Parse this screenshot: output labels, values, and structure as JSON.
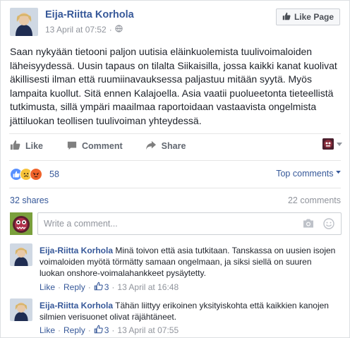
{
  "post": {
    "author": "Eija-Riitta Korhola",
    "timestamp": "13 April at 07:52",
    "separator": "·",
    "like_page_label": "Like Page",
    "text": "Saan nykyään tietooni paljon uutisia eläinkuolemista tuulivoimaloiden läheisyydessä. Uusin tapaus on tilalta Siikaisilla, jossa kaikki kanat kuolivat äkillisesti ilman että ruumiinavauksessa paljastuu mitään syytä. Myös lampaita kuollut. Sitä ennen Kalajoella. Asia vaatii puolueetonta tieteellistä tutkimusta, sillä ympäri maailmaa raportoidaan vastaavista ongelmista jättiluokan teollisen tuulivoiman yhteydessä."
  },
  "actions": {
    "like": "Like",
    "comment": "Comment",
    "share": "Share"
  },
  "reactions": {
    "count": "58",
    "icons": [
      "like-reaction-icon",
      "sad-reaction-icon",
      "angry-reaction-icon"
    ],
    "sort_label": "Top comments"
  },
  "stats": {
    "shares": "32 shares",
    "comments": "22 comments"
  },
  "comment_box": {
    "placeholder": "Write a comment..."
  },
  "comments": [
    {
      "author": "Eija-Riitta Korhola",
      "text": "Minä toivon että asia tutkitaan. Tanskassa on uusien isojen voimaloiden myötä törmätty samaan ongelmaan, ja siksi siellä on suuren luokan onshore-voimalahankkeet pysäytetty.",
      "like": "Like",
      "reply": "Reply",
      "likes": "3",
      "timestamp": "13 April at 16:48"
    },
    {
      "author": "Eija-Riitta Korhola",
      "text": "Tähän liittyy erikoinen yksityiskohta että kaikkien kanojen silmien verisuonet olivat räjähtäneet.",
      "like": "Like",
      "reply": "Reply",
      "likes": "3",
      "timestamp": "13 April at 07:55"
    }
  ],
  "colors": {
    "link": "#365899",
    "muted": "#90949c",
    "like_blue": "#5890ff",
    "angry_orange": "#f0632a",
    "sad_yellow": "#f7c33b"
  }
}
